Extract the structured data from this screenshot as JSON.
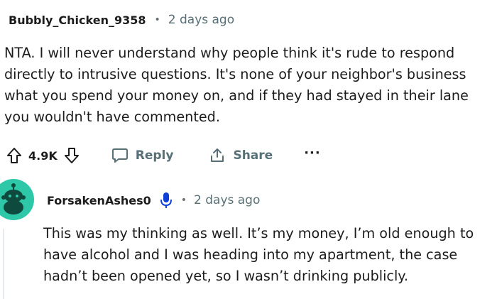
{
  "comment": {
    "username": "Bubbly_Chicken_9358",
    "separator": "•",
    "time": "2 days ago",
    "body": "NTA. I will never understand why people think it's rude to respond\ndirectly to intrusive questions. It's none of your neighbor's business\nwhat you spend your money on, and if they had stayed in their lane\nyou wouldn't have commented.",
    "score": "4.9K",
    "reply_label": "Reply",
    "share_label": "Share",
    "more_label": "···"
  },
  "reply": {
    "username": "ForsakenAshes0",
    "separator": "•",
    "time": "2 days ago",
    "body": "This was my thinking as well. It’s my money, I’m old enough to\nhave alcohol and I was heading into my apartment, the case\nhadn’t been opened yet, so I wasn’t drinking publicly.",
    "avatar_color": "#2ec7a7",
    "mic_color": "#0e3fd6"
  },
  "icons": {
    "upvote": "upvote-icon",
    "downvote": "downvote-icon",
    "reply": "comment-bubble-icon",
    "share": "share-icon",
    "mic": "microphone-icon"
  }
}
